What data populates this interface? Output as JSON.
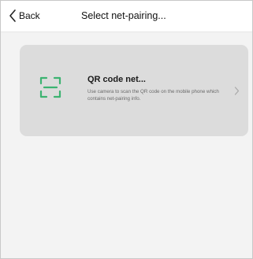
{
  "header": {
    "back_label": "Back",
    "title": "Select net-pairing..."
  },
  "options": [
    {
      "icon": "qr-scan-icon",
      "title": "QR code net...",
      "description": "Use camera to scan the QR code on the mobile phone which contains net-pairing info."
    }
  ],
  "colors": {
    "accent": "#3cb371",
    "card_background": "#dcdcdc",
    "page_background": "#f3f3f3",
    "header_background": "#ffffff"
  }
}
